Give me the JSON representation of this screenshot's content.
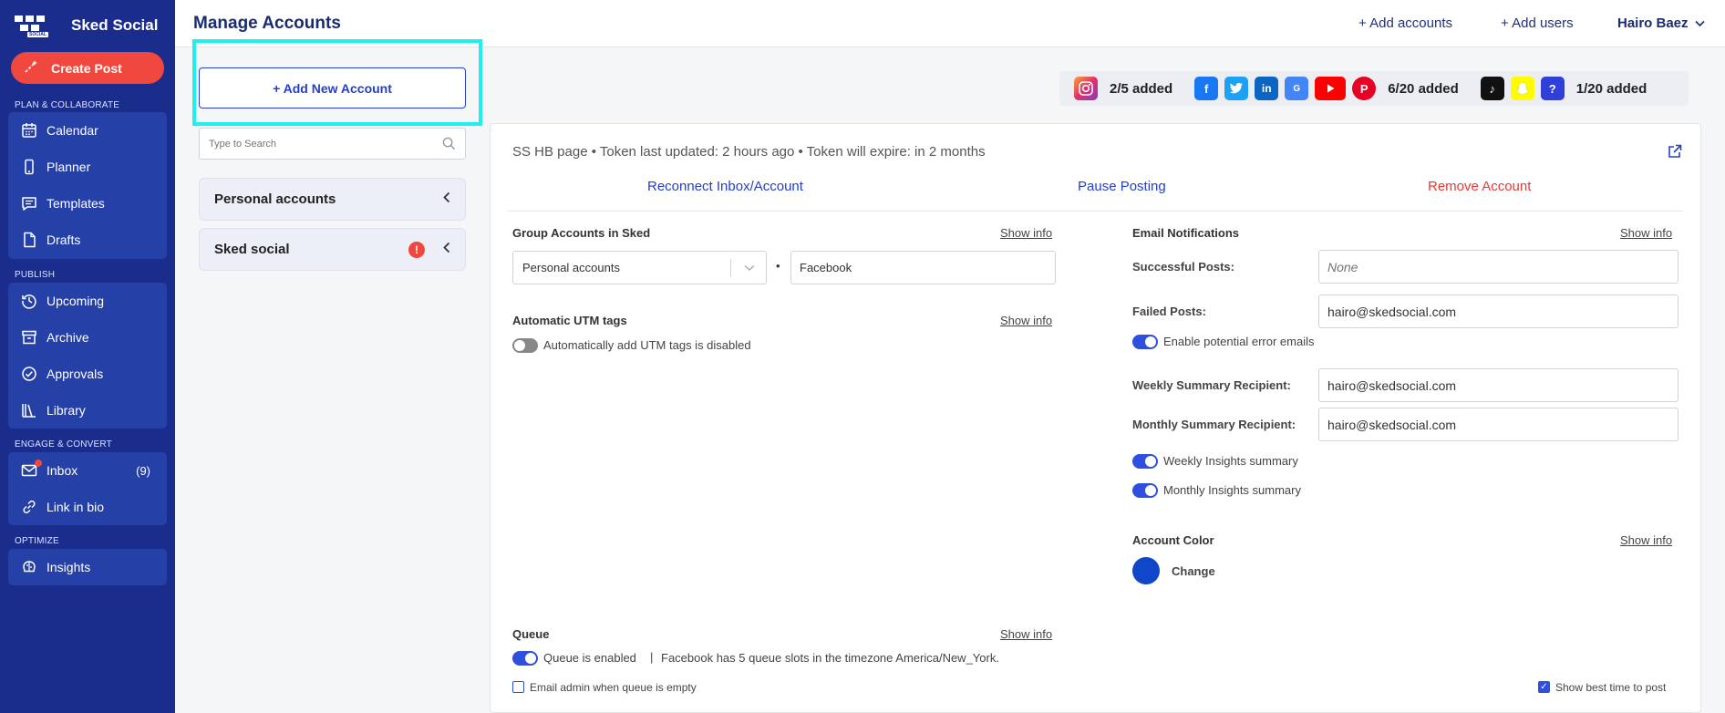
{
  "sidebar": {
    "brand": "Sked Social",
    "logo_text": "SOCIAL",
    "create_post": "Create Post",
    "sections": {
      "plan": "PLAN & COLLABORATE",
      "publish": "PUBLISH",
      "engage": "ENGAGE & CONVERT",
      "optimize": "OPTIMIZE"
    },
    "plan_items": [
      "Calendar",
      "Planner",
      "Templates",
      "Drafts"
    ],
    "publish_items": [
      "Upcoming",
      "Archive",
      "Approvals",
      "Library"
    ],
    "engage_items": [
      "Inbox",
      "Link in bio"
    ],
    "inbox_count": "(9)",
    "optimize_items": [
      "Insights"
    ]
  },
  "header": {
    "title": "Manage Accounts",
    "add_accounts": "+ Add accounts",
    "add_users": "+ Add users",
    "user": "Hairo Baez"
  },
  "accounts_panel": {
    "add_new": "+ Add New Account",
    "search_placeholder": "Type to Search",
    "groups": [
      "Personal accounts",
      "Sked social"
    ]
  },
  "quota": {
    "instagram": "2/5 added",
    "social": "6/20 added",
    "other": "1/20 added"
  },
  "account": {
    "header": "SS HB page  •  Token last updated: 2 hours ago  •  Token will expire: in 2 months",
    "reconnect": "Reconnect Inbox/Account",
    "pause": "Pause Posting",
    "remove": "Remove Account",
    "show_info": "Show info",
    "group_title": "Group Accounts in Sked",
    "group_value": "Personal accounts",
    "group_bullet": "•",
    "group_name_value": "Facebook",
    "utm_title": "Automatic UTM tags",
    "utm_label": "Automatically add UTM tags is disabled",
    "email_title": "Email Notifications",
    "successful_label": "Successful Posts:",
    "successful_placeholder": "None",
    "failed_label": "Failed Posts:",
    "failed_value": "hairo@skedsocial.com",
    "error_emails": "Enable potential error emails",
    "weekly_label": "Weekly Summary Recipient:",
    "weekly_value": "hairo@skedsocial.com",
    "monthly_label": "Monthly Summary Recipient:",
    "monthly_value": "hairo@skedsocial.com",
    "weekly_insights": "Weekly Insights summary",
    "monthly_insights": "Monthly Insights summary",
    "color_title": "Account Color",
    "color_change": "Change",
    "color_value": "#1046c8",
    "queue_title": "Queue",
    "queue_enabled": "Queue is enabled",
    "queue_separator": "|",
    "queue_info": "Facebook has 5 queue slots in the timezone America/New_York.",
    "queue_email": "Email admin when queue is empty",
    "best_time": "Show best time to post"
  },
  "colors": {
    "sidebar": "#1a2c8c",
    "accent": "#2540c8",
    "danger": "#f0483e",
    "highlight": "#1ef0f0"
  }
}
